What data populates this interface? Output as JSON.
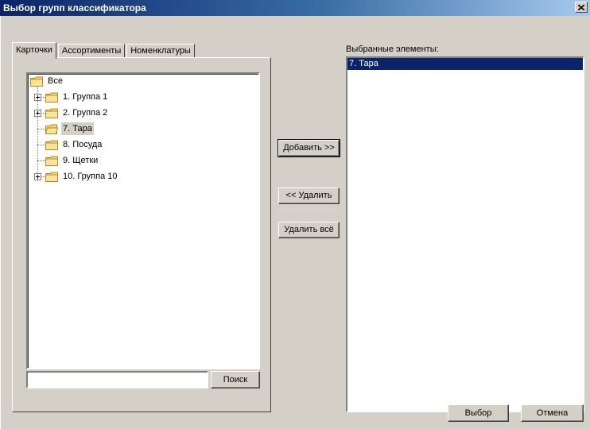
{
  "window": {
    "title": "Выбор групп классификатора"
  },
  "tabs": [
    "Карточки",
    "Ассортименты",
    "Номенклатуры"
  ],
  "tree": {
    "root": "Все",
    "items": [
      {
        "label": "1. Группа 1",
        "expandable": true
      },
      {
        "label": "2. Группа 2",
        "expandable": true
      },
      {
        "label": "7. Тара",
        "expandable": false,
        "selected": true
      },
      {
        "label": "8. Посуда",
        "expandable": false
      },
      {
        "label": "9. Щетки",
        "expandable": false
      },
      {
        "label": "10. Группа 10",
        "expandable": true
      }
    ]
  },
  "search": {
    "value": "",
    "button_label": "Поиск"
  },
  "actions": {
    "add_label": "Добавить >>",
    "remove_label": "<< Удалить",
    "remove_all_label": "Удалить всё"
  },
  "selected": {
    "label": "Выбранные элементы:",
    "items": [
      "7. Тара"
    ]
  },
  "footer": {
    "ok_label": "Выбор",
    "cancel_label": "Отмена"
  },
  "colors": {
    "titlebar_start": "#0a246a",
    "titlebar_end": "#a6caf0",
    "face": "#d4d0c8",
    "selection": "#0a246a"
  }
}
